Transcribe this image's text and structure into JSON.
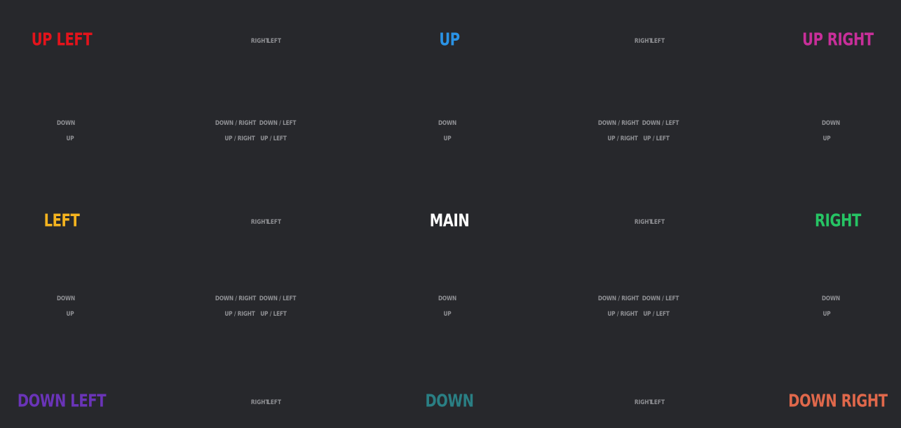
{
  "titles": {
    "up_left": "UP LEFT",
    "up": "UP",
    "up_right": "UP RIGHT",
    "left": "LEFT",
    "main": "MAIN",
    "right": "RIGHT",
    "down_left": "DOWN LEFT",
    "down": "DOWN",
    "down_right": "DOWN RIGHT"
  },
  "colors": {
    "up_left": "#e4131b",
    "up": "#2a93e6",
    "up_right": "#c82f9a",
    "left": "#f5b41f",
    "main": "#ffffff",
    "right": "#26c464",
    "down_left": "#6a34b8",
    "down": "#2a7f84",
    "down_right": "#e0684b",
    "nav_text": "#8f9094",
    "background": "#27282c"
  },
  "nav": {
    "right": "RIGHT",
    "left": "LEFT",
    "down": "DOWN",
    "up": "UP",
    "down_right": "DOWN / RIGHT",
    "down_left": "DOWN / LEFT",
    "up_right": "UP / RIGHT",
    "up_left": "UP / LEFT"
  }
}
